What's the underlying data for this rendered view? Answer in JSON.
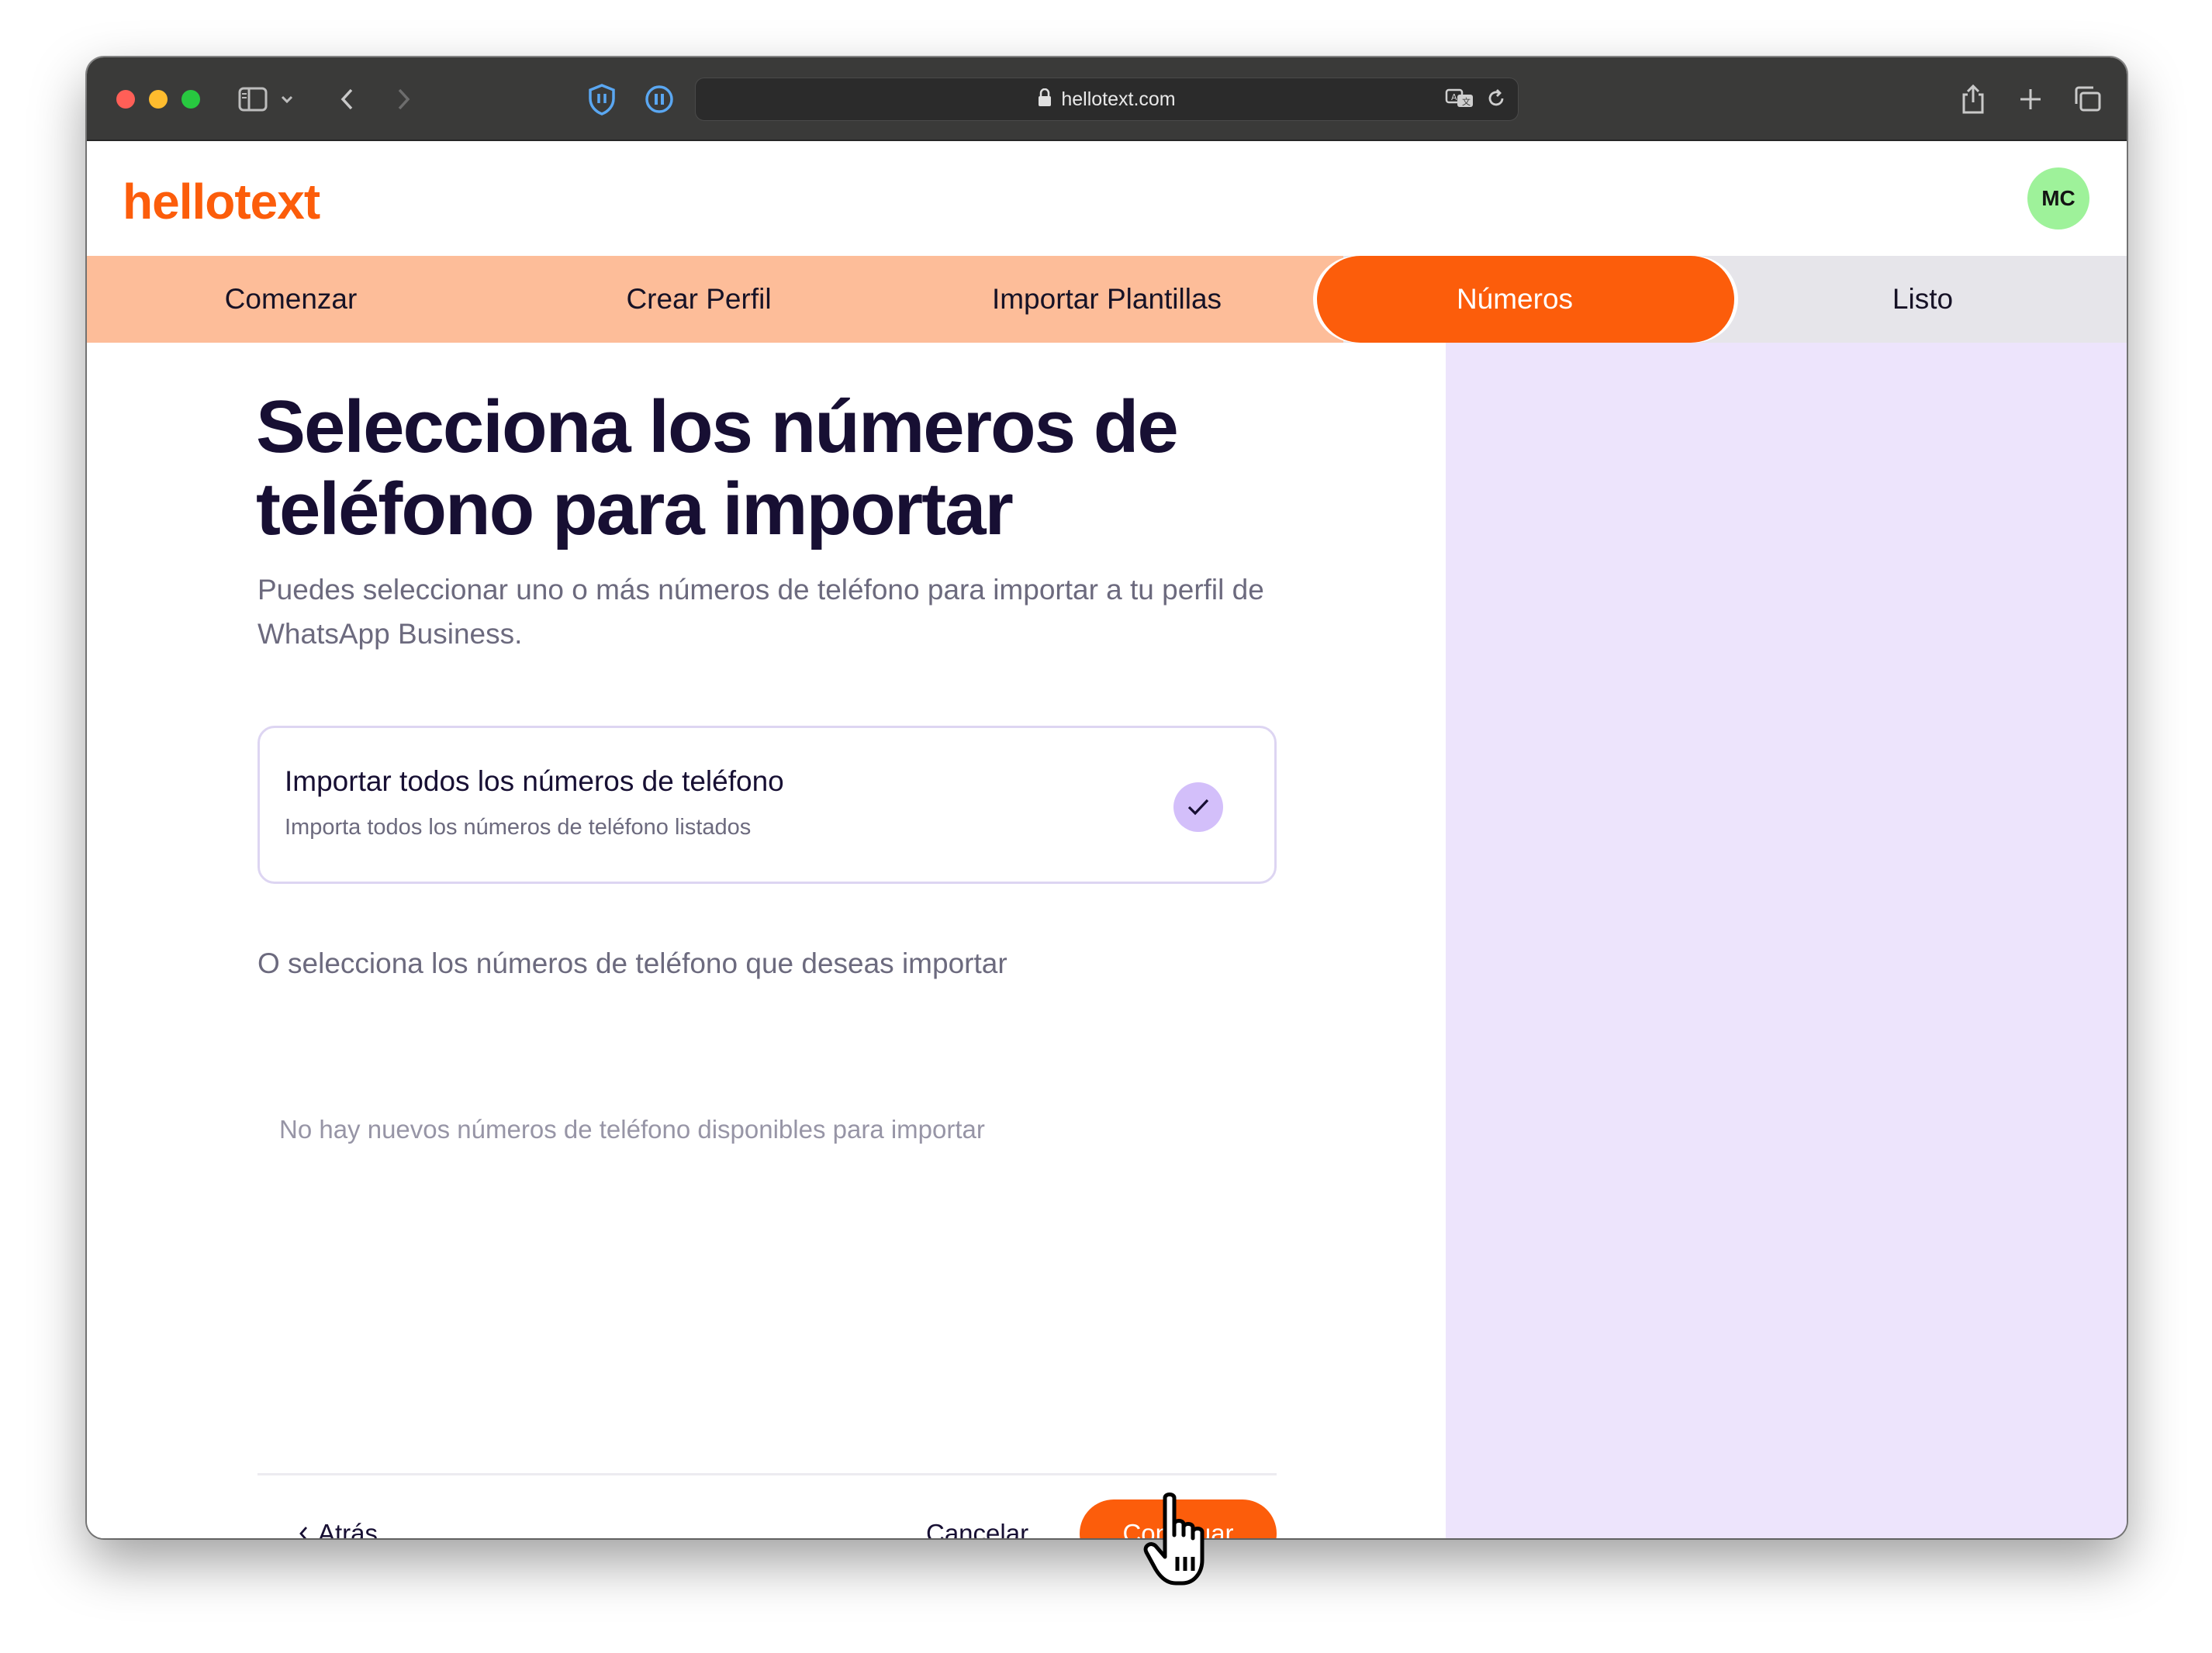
{
  "browser": {
    "url": "hellotext.com"
  },
  "app": {
    "logo_text": "hellotext",
    "avatar_initials": "MC",
    "colors": {
      "brand": "#fc5d0b",
      "step_done": "#fdbd99",
      "step_todo": "#e6e5ea",
      "panel": "#ede4fc",
      "avatar": "#9ef29a"
    }
  },
  "stepper": {
    "steps": [
      {
        "label": "Comenzar",
        "state": "done"
      },
      {
        "label": "Crear Perfil",
        "state": "done"
      },
      {
        "label": "Importar Plantillas",
        "state": "done"
      },
      {
        "label": "Números",
        "state": "active"
      },
      {
        "label": "Listo",
        "state": "todo"
      }
    ]
  },
  "main": {
    "title": "Selecciona los números de teléfono para importar",
    "subtitle": "Puedes seleccionar uno o más números de teléfono para importar a tu perfil de WhatsApp Business.",
    "import_all": {
      "title": "Importar todos los números de teléfono",
      "description": "Importa todos los números de teléfono listados",
      "checked": true
    },
    "or_select_text": "O selecciona los números de teléfono que deseas importar",
    "empty_text": "No hay nuevos números de teléfono disponibles para importar"
  },
  "footer": {
    "back_label": "Atrás",
    "cancel_label": "Cancelar",
    "continue_label": "Continuar"
  },
  "icons": [
    "sidebar-icon",
    "chevron-down-icon",
    "back-arrow-icon",
    "forward-arrow-icon",
    "shield-icon",
    "pause-icon",
    "lock-icon",
    "translate-icon",
    "reload-icon",
    "share-icon",
    "plus-icon",
    "tabs-icon",
    "checkmark-icon",
    "chevron-left-icon",
    "hand-pointer-icon"
  ]
}
